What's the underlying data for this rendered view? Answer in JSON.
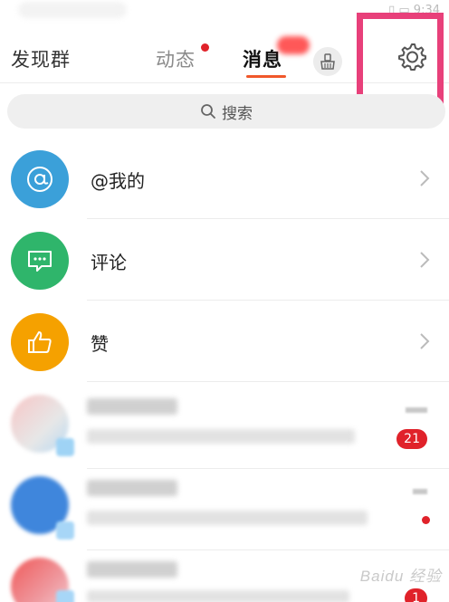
{
  "status_bar": {
    "right_text": "▯ ▭ 9:34"
  },
  "tabs": {
    "discover": "发现群",
    "feed": "动态",
    "messages": "消息"
  },
  "search": {
    "label": "搜索"
  },
  "fixed_rows": [
    {
      "label": "@我的",
      "icon": "at-icon",
      "color": "#3ba0d9"
    },
    {
      "label": "评论",
      "icon": "comment-icon",
      "color": "#2fb56b"
    },
    {
      "label": "赞",
      "icon": "thumbs-up-icon",
      "color": "#f5a100"
    }
  ],
  "conversations": [
    {
      "badge": "21"
    },
    {
      "badge": ""
    },
    {
      "badge": "1"
    }
  ],
  "watermark": "Baidu 经验",
  "colors": {
    "accent": "#f0572a",
    "badge_red": "#e0222a",
    "highlight_box": "#e8407a"
  }
}
